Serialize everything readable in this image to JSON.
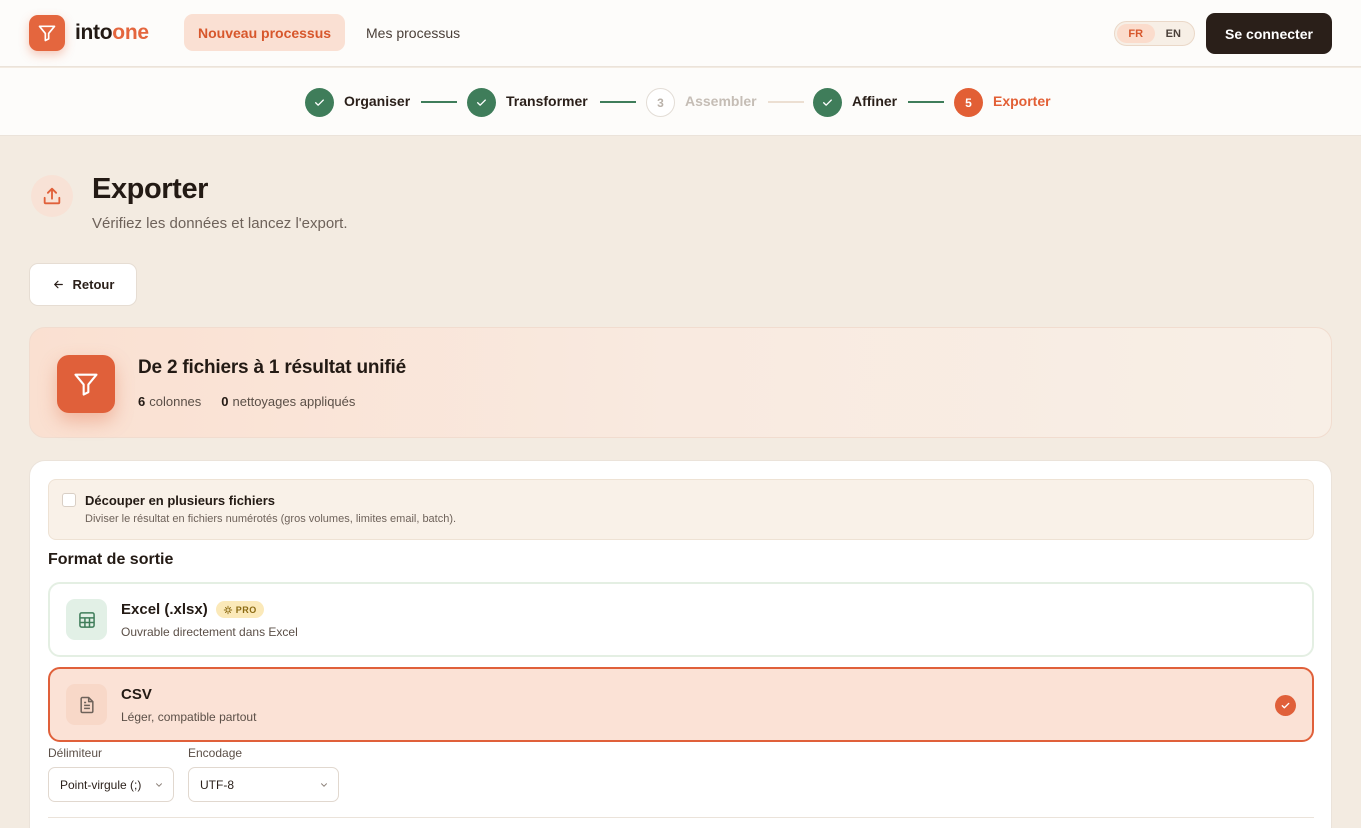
{
  "app": {
    "logo_into": "into",
    "logo_one": "one"
  },
  "nav": {
    "new_process": "Nouveau processus",
    "my_processes": "Mes processus"
  },
  "lang": {
    "fr": "FR",
    "en": "EN",
    "selected": "FR"
  },
  "header": {
    "connect": "Se connecter"
  },
  "stepper": {
    "steps": [
      {
        "label": "Organiser",
        "state": "done"
      },
      {
        "label": "Transformer",
        "state": "done"
      },
      {
        "number": "3",
        "label": "Assembler",
        "state": "pending"
      },
      {
        "label": "Affiner",
        "state": "done"
      },
      {
        "number": "5",
        "label": "Exporter",
        "state": "current"
      }
    ]
  },
  "page": {
    "title": "Exporter",
    "subtitle": "Vérifiez les données et lancez l'export.",
    "back": "Retour"
  },
  "summary": {
    "title": "De 2 fichiers à 1 résultat unifié",
    "columns_count": "6",
    "columns_label": "colonnes",
    "cleanings_count": "0",
    "cleanings_label": "nettoyages appliqués"
  },
  "split": {
    "label": "Découper en plusieurs fichiers",
    "description": "Diviser le résultat en fichiers numérotés (gros volumes, limites email, batch).",
    "checked": false
  },
  "format": {
    "section_title": "Format de sortie",
    "options": [
      {
        "title": "Excel (.xlsx)",
        "badge": "PRO",
        "description": "Ouvrable directement dans Excel",
        "selected": false
      },
      {
        "title": "CSV",
        "description": "Léger, compatible partout",
        "selected": true
      }
    ]
  },
  "csv_options": {
    "delimiter_label": "Délimiteur",
    "delimiter_value": "Point-virgule (;)",
    "encoding_label": "Encodage",
    "encoding_value": "UTF-8"
  },
  "colors": {
    "accent": "#e0603a",
    "success": "#3f7d5a",
    "dark": "#2a1f19",
    "background": "#f3ebe1"
  }
}
